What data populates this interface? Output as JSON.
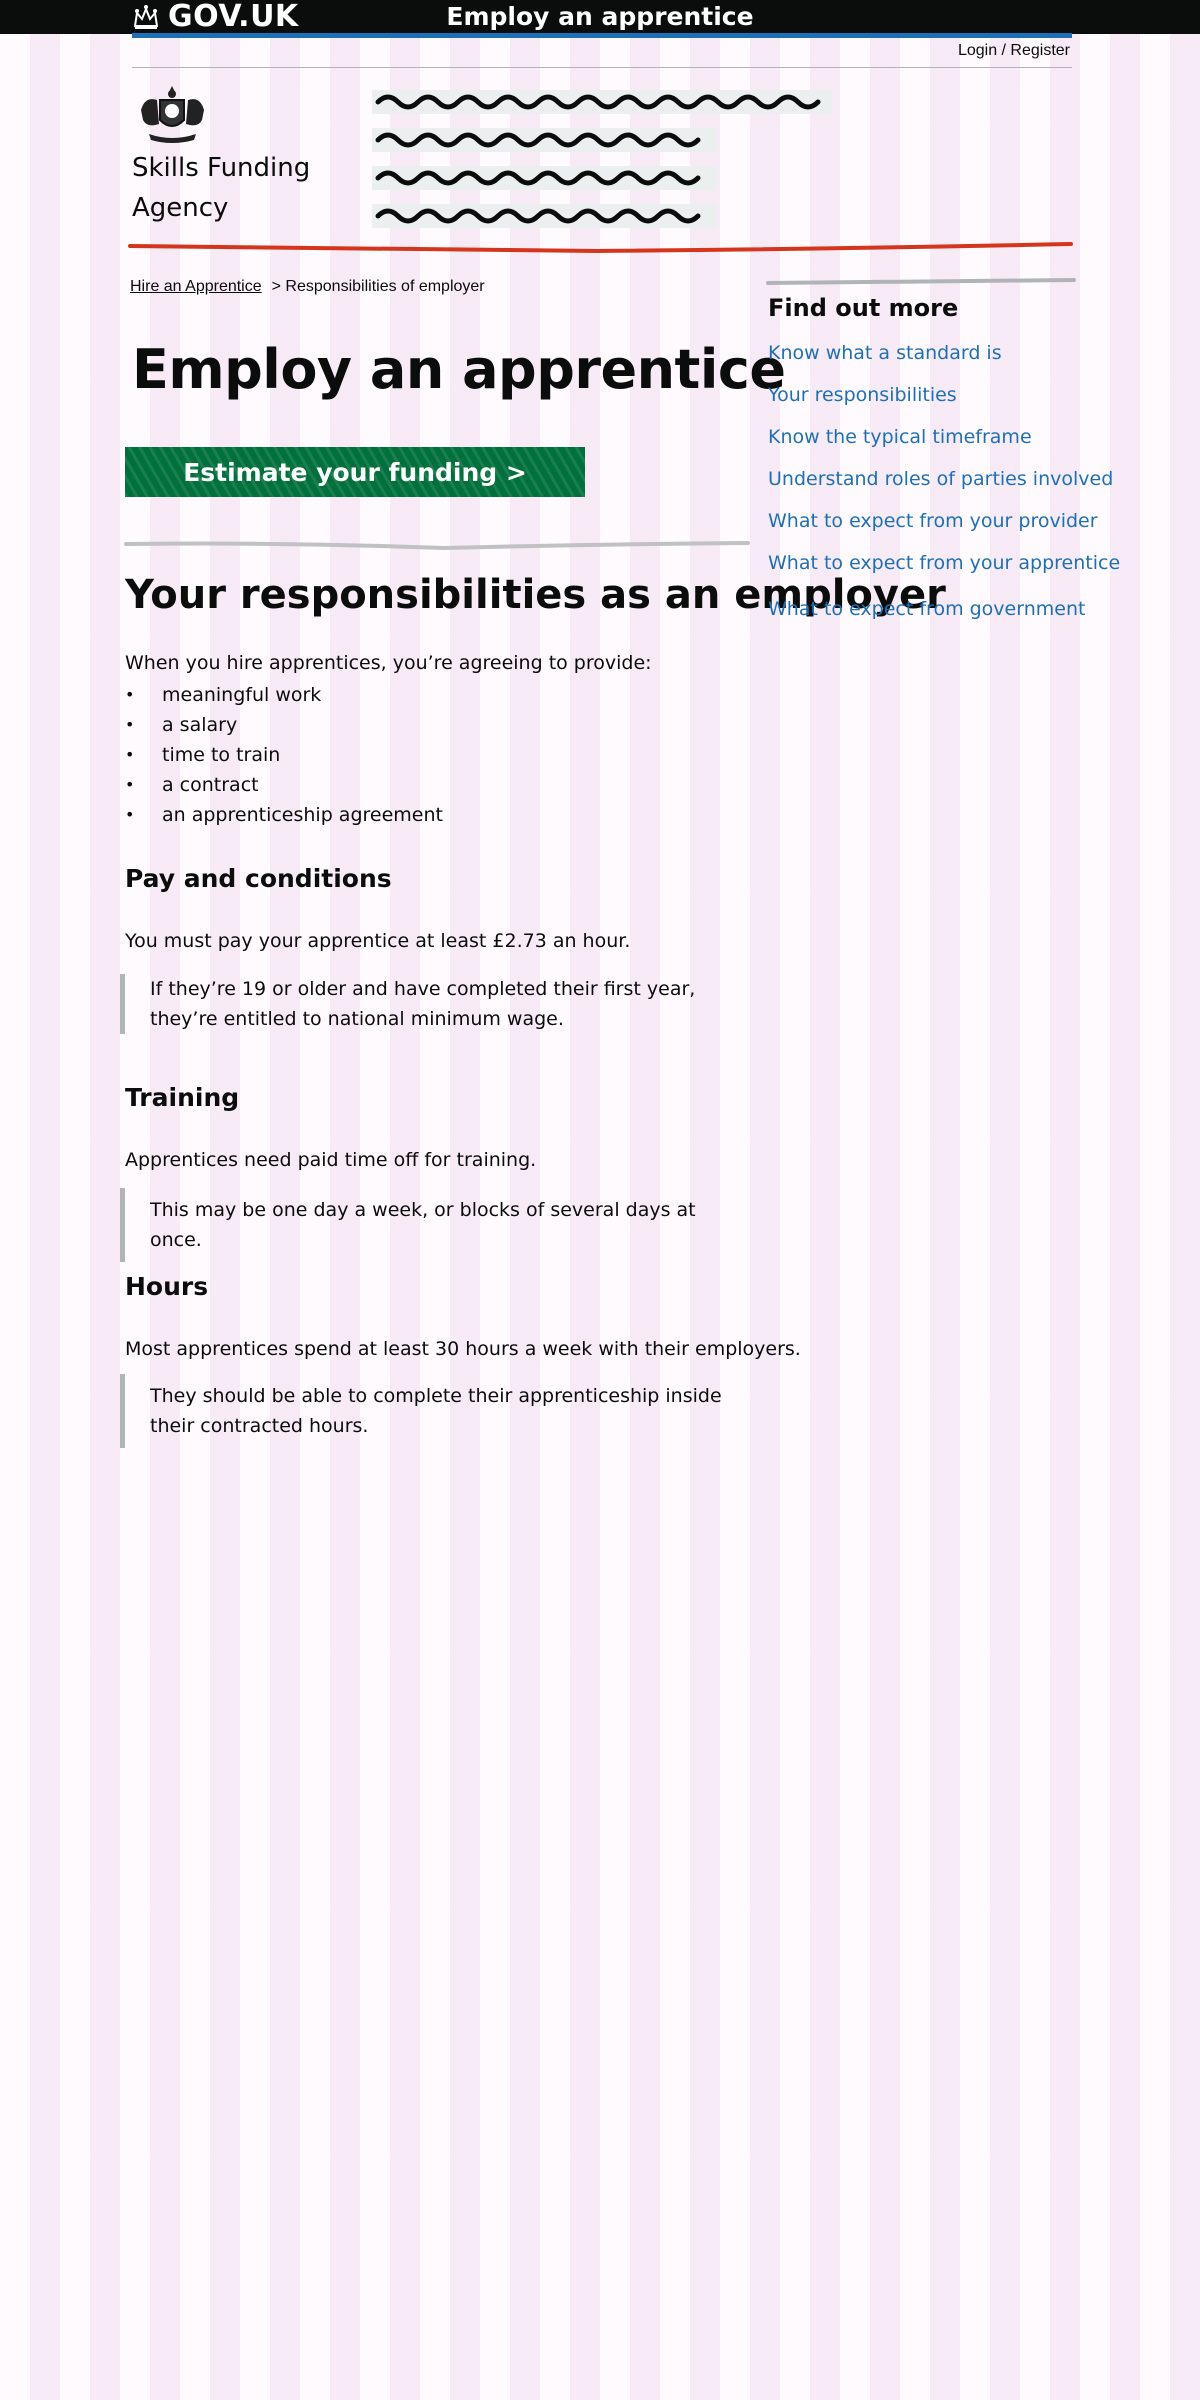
{
  "header": {
    "logo_text": "GOV.UK",
    "page_title": "Employ an apprentice",
    "login_link": "Login / Register"
  },
  "agency": {
    "name": "Skills Funding Agency"
  },
  "breadcrumb": {
    "home": "Hire an Apprentice",
    "current": "> Responsibilities of employer"
  },
  "main": {
    "heading": "Employ an apprentice",
    "cta_label": "Estimate your funding >",
    "section_heading": "Your responsibilities as an employer",
    "intro": "When you hire apprentices, you’re agreeing to provide:",
    "provisions": [
      "meaningful work",
      "a salary",
      "time to train",
      "a contract",
      "an apprenticeship agreement"
    ],
    "pay": {
      "heading": "Pay and conditions",
      "text": "You must pay your apprentice at least £2.73 an hour.",
      "inset": "If they’re 19 or older and have completed their first year, they’re entitled to national minimum wage."
    },
    "training": {
      "heading": "Training",
      "text": "Apprentices need paid time off for training.",
      "inset": "This may be one day a week, or blocks of several days at once."
    },
    "hours": {
      "heading": "Hours",
      "text": "Most apprentices spend at least 30 hours a week with their employers.",
      "inset": "They should be able to complete their apprenticeship inside their contracted hours."
    }
  },
  "sidebar": {
    "title": "Find out more",
    "links": [
      "Know what a standard is",
      "Your responsibilities",
      "Know the typical timeframe",
      "Understand roles of parties involved",
      "What to expect from your provider",
      "What to expect from your apprentice",
      "What to expect from government"
    ]
  },
  "colors": {
    "topbar": "#0b0c0c",
    "accent_blue": "#1d70b8",
    "red_rule": "#d4351c",
    "button_green": "#00703c",
    "link": "#1d70b8",
    "inset_border": "#b1b4b6"
  },
  "icons": [
    "crown-icon",
    "royal-crest-icon"
  ]
}
